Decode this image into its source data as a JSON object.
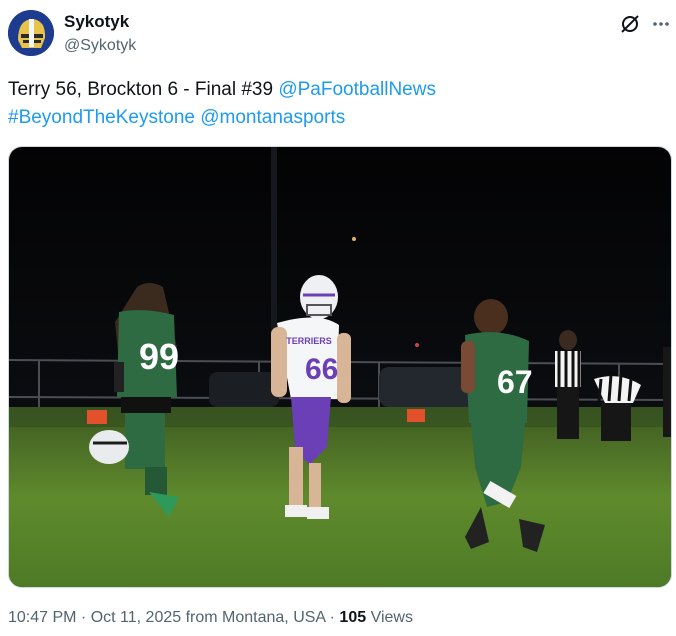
{
  "author": {
    "display_name": "Sykotyk",
    "handle": "@Sykotyk",
    "avatar_icon": "avatar-helmet-icon"
  },
  "actions": {
    "grok_icon": "grok-icon",
    "more_icon": "more-icon"
  },
  "tweet": {
    "text_main": "Terry 56, Brockton 6 - Final #39 ",
    "mention_1": "@PaFootballNews",
    "hashtag_1": "#BeyondTheKeystone",
    "text_space": " ",
    "mention_2": "@montanasports"
  },
  "photo": {
    "jersey_left": "99",
    "jersey_center": "66",
    "jersey_right": "67",
    "jersey_center_team": "TERRIERS"
  },
  "meta": {
    "time": "10:47 PM",
    "separator": " · ",
    "date": "Oct 11, 2025",
    "location": " from Montana, USA",
    "separator2": " · ",
    "views_count": "105",
    "views_label": " Views"
  },
  "colors": {
    "link": "#1d9bf0",
    "text": "#0f1419",
    "muted": "#536471",
    "green_jersey": "#1f5a3a",
    "purple": "#6b3fb5"
  }
}
